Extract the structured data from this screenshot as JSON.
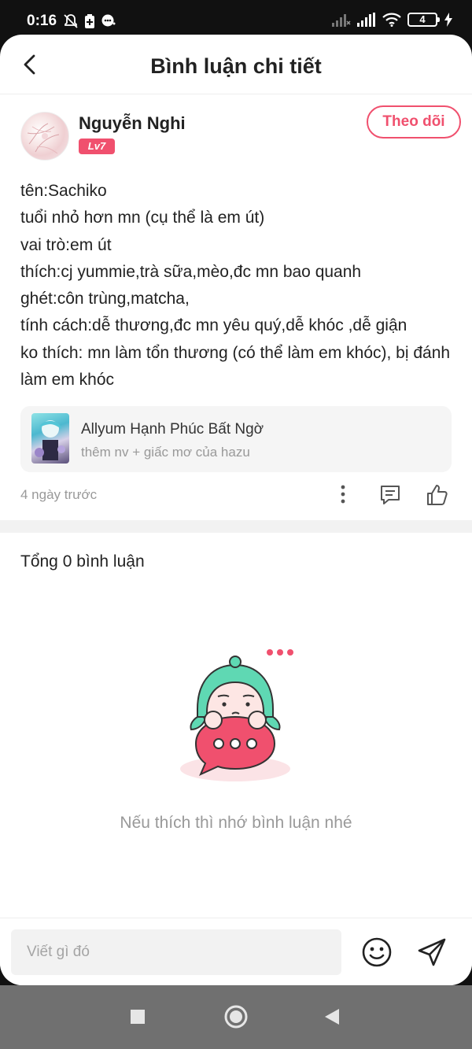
{
  "status_bar": {
    "time": "0:16",
    "battery": "4"
  },
  "header": {
    "title": "Bình luận chi tiết"
  },
  "author": {
    "name": "Nguyễn Nghi",
    "level": "Lv7",
    "follow_label": "Theo dõi"
  },
  "post": {
    "lines": [
      "tên:Sachiko",
      "tuổi nhỏ hơn mn (cụ thể là em út)",
      "vai trò:em út",
      "thích:cj yummie,trà sữa,mèo,đc mn bao quanh",
      "ghét:côn trùng,matcha,",
      "tính cách:dễ thương,đc mn yêu quý,dễ khóc ,dễ giận",
      "ko thích: mn làm tổn thương (có thể làm em khóc), bị đánh làm em khóc"
    ],
    "time_ago": "4 ngày trước"
  },
  "linked_story": {
    "title": "Allyum Hạnh Phúc Bất Ngờ",
    "subtitle": "thêm nv + giấc mơ của hazu"
  },
  "comments": {
    "total_label": "Tổng 0 bình luận",
    "empty_message": "Nếu thích thì nhớ bình luận nhé"
  },
  "input": {
    "placeholder": "Viết gì đó"
  },
  "colors": {
    "accent": "#f0506e",
    "character_hair": "#5fd8b3",
    "bubble": "#f0506e"
  },
  "icons": {
    "back": "chevron-left-icon",
    "more": "more-vertical-icon",
    "comment": "comment-icon",
    "like": "thumbs-up-icon",
    "emoji": "smiley-icon",
    "send": "send-icon"
  }
}
